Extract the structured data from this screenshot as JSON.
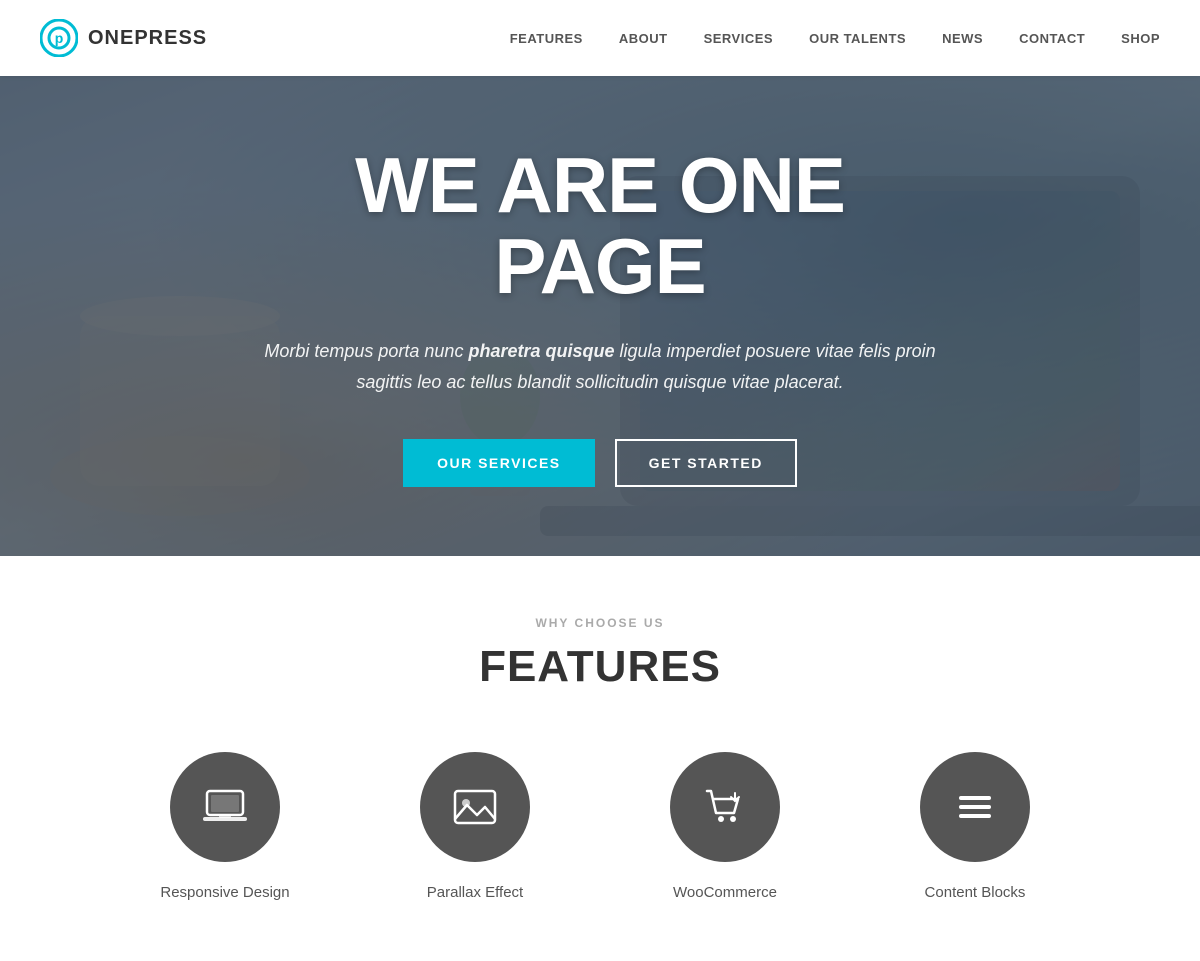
{
  "header": {
    "logo_text": "ONEPRESS",
    "nav_items": [
      {
        "label": "FEATURES",
        "href": "#features"
      },
      {
        "label": "ABOUT",
        "href": "#about"
      },
      {
        "label": "SERVICES",
        "href": "#services"
      },
      {
        "label": "OUR TALENTS",
        "href": "#talents"
      },
      {
        "label": "NEWS",
        "href": "#news"
      },
      {
        "label": "CONTACT",
        "href": "#contact"
      },
      {
        "label": "SHOP",
        "href": "#shop"
      }
    ]
  },
  "hero": {
    "title": "WE ARE ONE PAGE",
    "subtitle_plain1": "Morbi tempus porta nunc ",
    "subtitle_bold": "pharetra quisque",
    "subtitle_plain2": " ligula imperdiet posuere vitae felis proin sagittis leo ac tellus blandit sollicitudin quisque vitae placerat.",
    "button_primary": "OUR SERVICES",
    "button_outline": "GET STARTED"
  },
  "features": {
    "eyebrow": "WHY CHOOSE US",
    "title": "FEATURES",
    "items": [
      {
        "label": "Responsive Design",
        "icon": "laptop"
      },
      {
        "label": "Parallax Effect",
        "icon": "image"
      },
      {
        "label": "WooCommerce",
        "icon": "cart"
      },
      {
        "label": "Content Blocks",
        "icon": "menu"
      }
    ]
  }
}
